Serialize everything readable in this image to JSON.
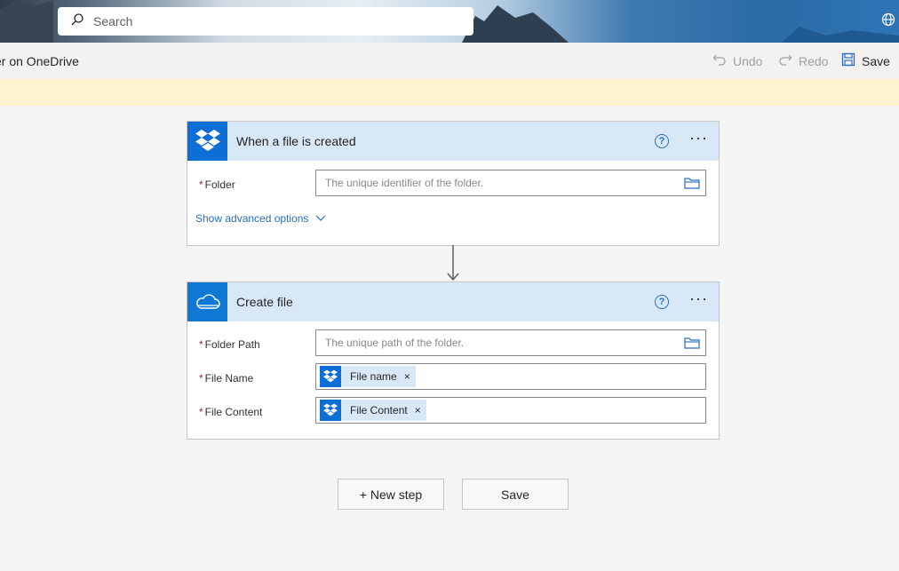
{
  "header": {
    "search": {
      "label": "Search"
    }
  },
  "commandbar": {
    "flow_name": "er on OneDrive",
    "undo": "Undo",
    "redo": "Redo",
    "save": "Save"
  },
  "trigger_card": {
    "title": "When a file is created",
    "icon": "dropbox-icon",
    "fields": [
      {
        "label": "Folder",
        "required": true,
        "placeholder": "The unique identifier of the folder."
      }
    ],
    "advanced_options": "Show advanced options"
  },
  "action_card": {
    "title": "Create file",
    "icon": "onedrive-icon",
    "fields": [
      {
        "label": "Folder Path",
        "required": true,
        "placeholder": "The unique path of the folder."
      },
      {
        "label": "File Name",
        "required": true,
        "token": "File name"
      },
      {
        "label": "File Content",
        "required": true,
        "token": "File Content"
      }
    ]
  },
  "footer": {
    "new_step": "+ New step",
    "save": "Save"
  },
  "colors": {
    "accent": "#0f78d4",
    "card_header": "#d9e8f7",
    "notice": "#fff4ce",
    "link": "#2a6dc0"
  }
}
